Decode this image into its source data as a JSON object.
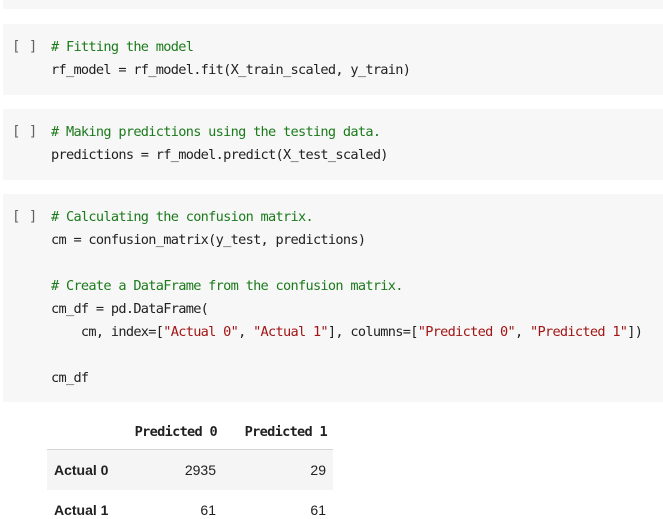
{
  "run_button_label": "[ ]",
  "cells": [
    {
      "lines": [
        [
          {
            "t": "# Fitting the model",
            "k": "cm"
          }
        ],
        [
          {
            "t": "rf_model = rf_model.fit(X_train_scaled, y_train)",
            "k": ""
          }
        ]
      ]
    },
    {
      "lines": [
        [
          {
            "t": "# Making predictions using the testing data.",
            "k": "cm"
          }
        ],
        [
          {
            "t": "predictions = rf_model.predict(X_test_scaled)",
            "k": ""
          }
        ]
      ]
    },
    {
      "lines": [
        [
          {
            "t": "# Calculating the confusion matrix.",
            "k": "cm"
          }
        ],
        [
          {
            "t": "cm = confusion_matrix(y_test, predictions)",
            "k": ""
          }
        ],
        [],
        [
          {
            "t": "# Create a DataFrame from the confusion matrix.",
            "k": "cm"
          }
        ],
        [
          {
            "t": "cm_df = pd.DataFrame(",
            "k": ""
          }
        ],
        [
          {
            "t": "    cm, index=[",
            "k": ""
          },
          {
            "t": "\"Actual 0\"",
            "k": "str"
          },
          {
            "t": ", ",
            "k": ""
          },
          {
            "t": "\"Actual 1\"",
            "k": "str"
          },
          {
            "t": "], columns=[",
            "k": ""
          },
          {
            "t": "\"Predicted 0\"",
            "k": "str"
          },
          {
            "t": ", ",
            "k": ""
          },
          {
            "t": "\"Predicted 1\"",
            "k": "str"
          },
          {
            "t": "])",
            "k": ""
          }
        ],
        [],
        [
          {
            "t": "cm_df",
            "k": ""
          }
        ]
      ]
    }
  ],
  "output": {
    "columns": [
      "Predicted 0",
      "Predicted 1"
    ],
    "rows": [
      {
        "label": "Actual 0",
        "values": [
          "2935",
          "29"
        ]
      },
      {
        "label": "Actual 1",
        "values": [
          "61",
          "61"
        ]
      }
    ]
  }
}
